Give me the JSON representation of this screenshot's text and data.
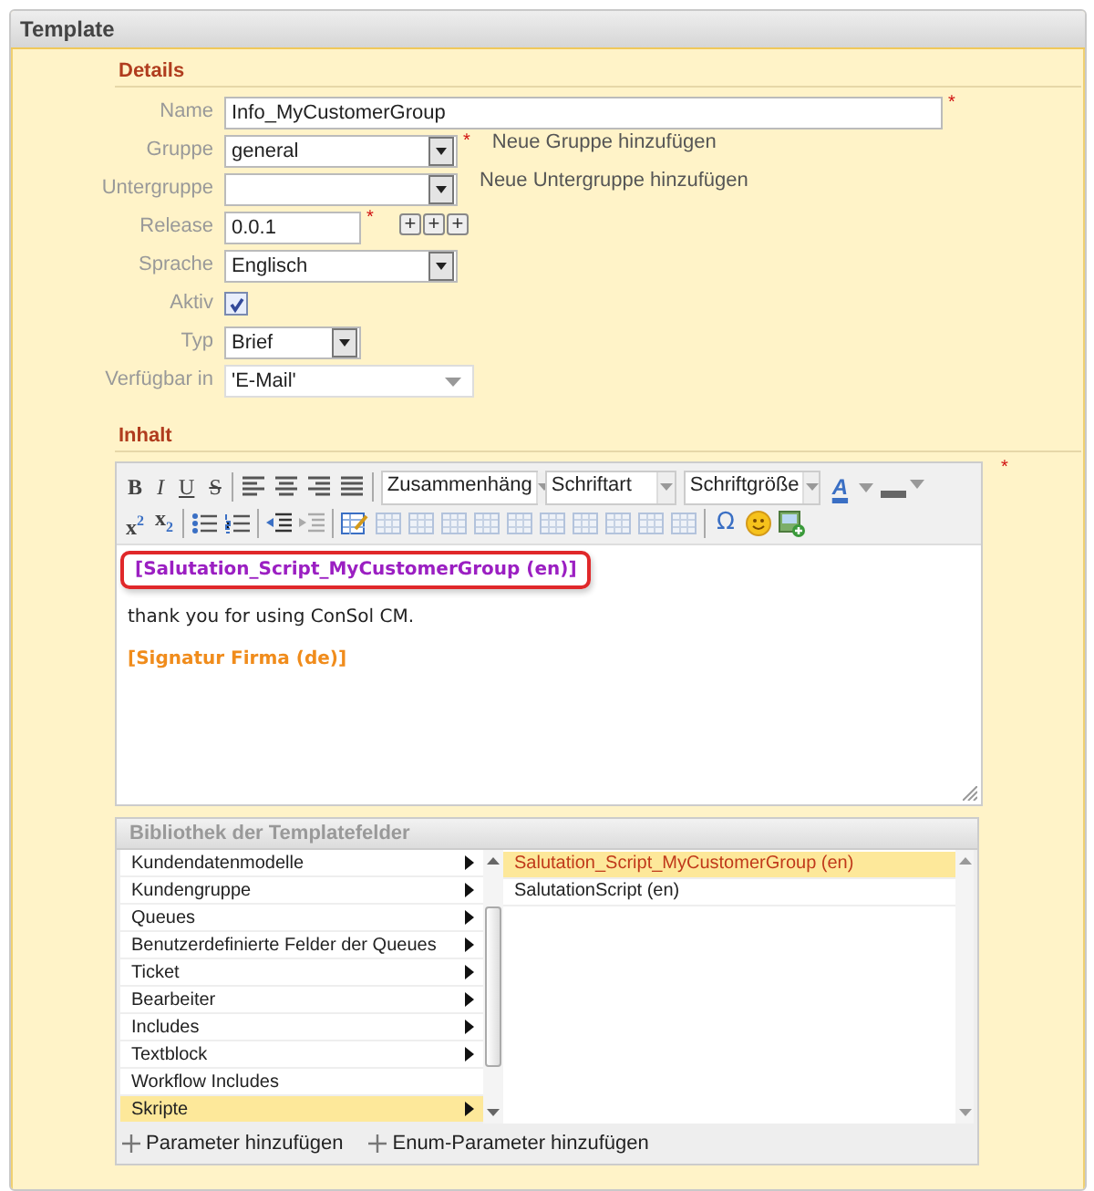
{
  "panel": {
    "title": "Template"
  },
  "details": {
    "heading": "Details",
    "fields": [
      {
        "label": "Name",
        "kind": "text",
        "value": "Info_MyCustomerGroup",
        "required_mark": "*"
      },
      {
        "label": "Gruppe",
        "kind": "select",
        "value": "general",
        "required_mark": "*",
        "link": "Neue Gruppe hinzufügen"
      },
      {
        "label": "Untergruppe",
        "kind": "select",
        "link": "Neue Untergruppe hinzufügen"
      },
      {
        "label": "Release",
        "kind": "version",
        "value": "0.0.1",
        "required_mark": "*",
        "buttons": [
          "+",
          "+",
          "+"
        ]
      },
      {
        "label": "Sprache",
        "kind": "select",
        "value": "Englisch"
      },
      {
        "label": "Aktiv",
        "kind": "checkbox",
        "checked": true
      },
      {
        "label": "Typ",
        "kind": "small-select",
        "value": "Brief"
      },
      {
        "label": "Verfügbar in",
        "kind": "multiselect",
        "value": "'E-Mail'"
      }
    ]
  },
  "content": {
    "heading": "Inhalt",
    "required_mark": "*",
    "toolbar": {
      "format_buttons": [
        "B",
        "I",
        "U",
        "S"
      ],
      "dropdowns": [
        "Zusammenhäng",
        "Schriftart",
        "Schriftgröße"
      ],
      "font_color": "A",
      "script_buttons": [
        "x$^{2}$",
        "x$_{2}$"
      ],
      "symbol": "Ω"
    },
    "paragraphs": [
      {
        "kind": "highlighted-field",
        "text": "[Salutation_Script_MyCustomerGroup (en)]"
      },
      {
        "kind": "plain",
        "text": "thank you for using ConSol CM."
      },
      {
        "kind": "field",
        "text": "[Signatur Firma (de)]"
      }
    ]
  },
  "library": {
    "title": "Bibliothek der Templatefelder",
    "categories": [
      {
        "label": "Kundendatenmodelle",
        "submenu": true,
        "selected": false
      },
      {
        "label": "Kundengruppe",
        "submenu": true,
        "selected": false
      },
      {
        "label": "Queues",
        "submenu": true,
        "selected": false
      },
      {
        "label": "Benutzerdefinierte Felder der Queues",
        "submenu": true,
        "selected": false
      },
      {
        "label": "Ticket",
        "submenu": true,
        "selected": false
      },
      {
        "label": "Bearbeiter",
        "submenu": true,
        "selected": false
      },
      {
        "label": "Includes",
        "submenu": true,
        "selected": false
      },
      {
        "label": "Textblock",
        "submenu": true,
        "selected": false
      },
      {
        "label": "Workflow Includes",
        "submenu": false,
        "selected": false
      },
      {
        "label": "Skripte",
        "submenu": true,
        "selected": true
      }
    ],
    "entries": [
      {
        "label": "Salutation_Script_MyCustomerGroup (en)",
        "selected": true
      },
      {
        "label": "SalutationScript (en)",
        "selected": false
      }
    ],
    "actions": [
      "Parameter hinzufügen",
      "Enum-Parameter hinzufügen"
    ]
  }
}
